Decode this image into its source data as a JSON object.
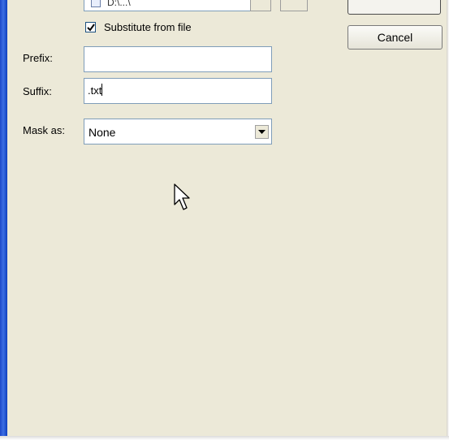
{
  "window": {
    "ok_button_label": "",
    "cancel_button_label": "Cancel"
  },
  "top_row": {
    "combo_text": "D:\\...\\"
  },
  "substitute": {
    "checked": true,
    "label": "Substitute from file"
  },
  "prefix": {
    "label": "Prefix:",
    "value": ""
  },
  "suffix": {
    "label": "Suffix:",
    "value": ".txt"
  },
  "mask": {
    "label": "Mask as:",
    "selected": "None"
  },
  "icons": {
    "checkbox": "checkmark-icon",
    "dropdown": "chevron-down-icon",
    "cursor": "mouse-pointer-icon",
    "doc": "document-icon"
  }
}
